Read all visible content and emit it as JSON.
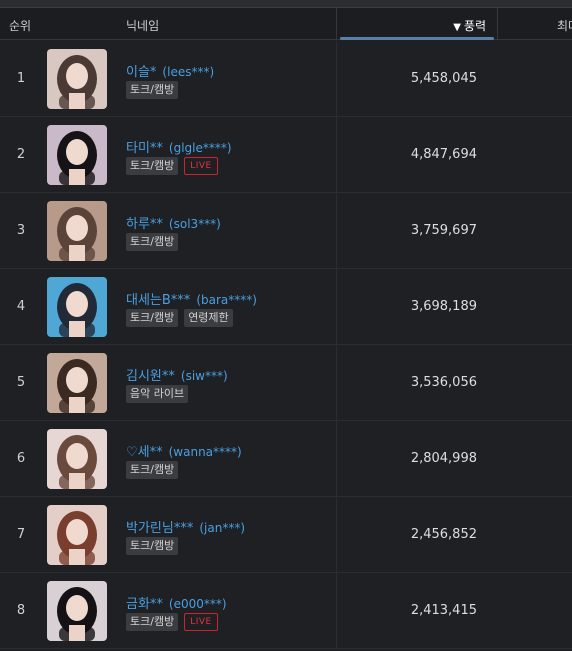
{
  "header": {
    "rank_label": "순위",
    "nick_label": "닉네임",
    "power_label": "풍력",
    "sort_arrow": "▼",
    "next_label": "최대"
  },
  "rows": [
    {
      "rank": "1",
      "name": "이슬*",
      "uid": "(lees***)",
      "tags": [
        "토크/캠방"
      ],
      "live": "",
      "power": "5,458,045",
      "avatar_color": "#d9c8c2",
      "hair_color": "#4a3a36"
    },
    {
      "rank": "2",
      "name": "타미**",
      "uid": "(glgle****)",
      "tags": [
        "토크/캠방"
      ],
      "live": "LIVE",
      "power": "4,847,694",
      "avatar_color": "#c9b9c9",
      "hair_color": "#151316"
    },
    {
      "rank": "3",
      "name": "하루**",
      "uid": "(sol3***)",
      "tags": [
        "토크/캠방"
      ],
      "live": "",
      "power": "3,759,697",
      "avatar_color": "#b89a8a",
      "hair_color": "#5a4338"
    },
    {
      "rank": "4",
      "name": "대세는B***",
      "uid": "(bara****)",
      "tags": [
        "토크/캠방",
        "연령제한"
      ],
      "live": "",
      "power": "3,698,189",
      "avatar_color": "#4fa7d6",
      "hair_color": "#222a38"
    },
    {
      "rank": "5",
      "name": "김시원**",
      "uid": "(siw***)",
      "tags": [
        "음악 라이브"
      ],
      "live": "",
      "power": "3,536,056",
      "avatar_color": "#c2a898",
      "hair_color": "#3b2a22"
    },
    {
      "rank": "6",
      "name": "♡세**",
      "uid": "(wanna****)",
      "tags": [
        "토크/캠방"
      ],
      "live": "",
      "power": "2,804,998",
      "avatar_color": "#e6d6d4",
      "hair_color": "#6b4a3e"
    },
    {
      "rank": "7",
      "name": "박가린님***",
      "uid": "(jan***)",
      "tags": [
        "토크/캠방"
      ],
      "live": "",
      "power": "2,456,852",
      "avatar_color": "#e4cfc8",
      "hair_color": "#7a3e2e"
    },
    {
      "rank": "8",
      "name": "금화**",
      "uid": "(e000***)",
      "tags": [
        "토크/캠방"
      ],
      "live": "LIVE",
      "power": "2,413,415",
      "avatar_color": "#d8d0d4",
      "hair_color": "#141214"
    }
  ]
}
